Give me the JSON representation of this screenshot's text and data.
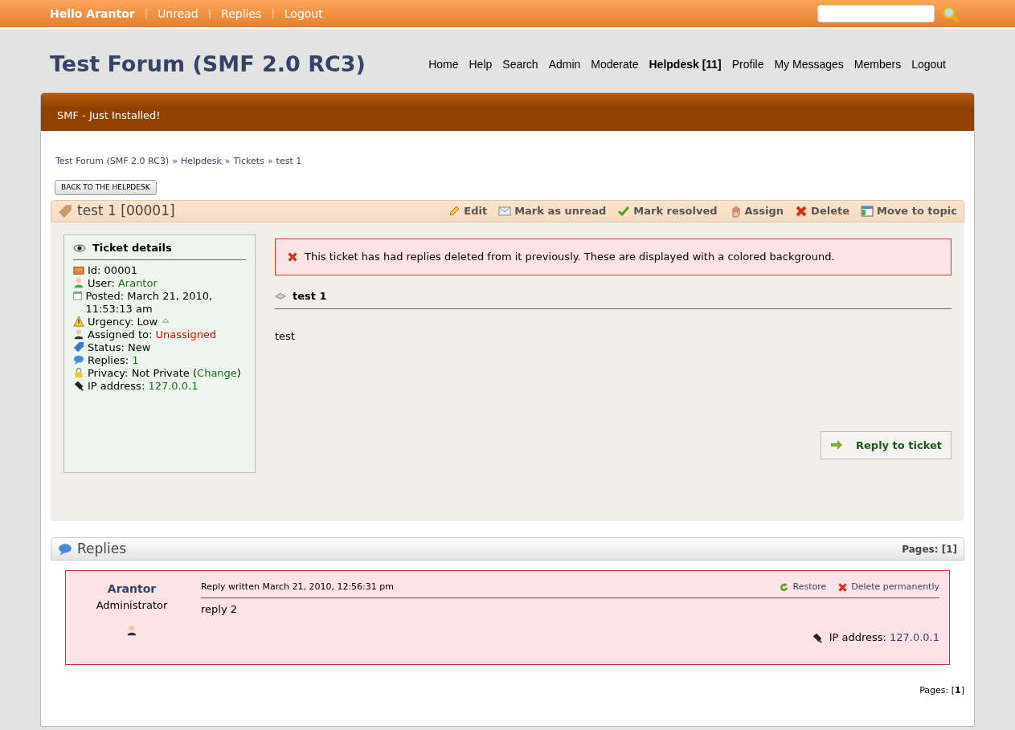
{
  "top_bar": {
    "greeting": "Hello Arantor",
    "separator": "|",
    "links": [
      "Unread",
      "Replies",
      "Logout"
    ]
  },
  "header": {
    "title": "Test Forum (SMF 2.0 RC3)",
    "menu": [
      {
        "label": "Home",
        "selected": false
      },
      {
        "label": "Help",
        "selected": false
      },
      {
        "label": "Search",
        "selected": false
      },
      {
        "label": "Admin",
        "selected": false
      },
      {
        "label": "Moderate",
        "selected": false
      },
      {
        "label": "Helpdesk [11]",
        "selected": true
      },
      {
        "label": "Profile",
        "selected": false
      },
      {
        "label": "My Messages",
        "selected": false
      },
      {
        "label": "Members",
        "selected": false
      },
      {
        "label": "Logout",
        "selected": false
      }
    ]
  },
  "banner": "SMF - Just Installed!",
  "breadcrumbs": {
    "separator": "»",
    "items": [
      "Test Forum (SMF 2.0 RC3)",
      "Helpdesk",
      "Tickets",
      "test 1"
    ]
  },
  "back_button": "BACK TO THE HELPDESK",
  "ticket": {
    "title": "test 1 [00001]",
    "actions": [
      {
        "kind": "edit",
        "label": "Edit"
      },
      {
        "kind": "unread",
        "label": "Mark as unread"
      },
      {
        "kind": "resolve",
        "label": "Mark resolved"
      },
      {
        "kind": "assign",
        "label": "Assign"
      },
      {
        "kind": "delete",
        "label": "Delete"
      },
      {
        "kind": "move",
        "label": "Move to topic"
      }
    ],
    "details": {
      "heading": "Ticket details",
      "rows": [
        {
          "kind": "id",
          "parts": [
            {
              "text": "Id: 00001"
            }
          ]
        },
        {
          "kind": "user",
          "parts": [
            {
              "text": "User: "
            },
            {
              "text": "Arantor",
              "link": true
            }
          ]
        },
        {
          "kind": "posted",
          "parts": [
            {
              "text": "Posted: March 21, 2010, 11:53:13 am"
            }
          ]
        },
        {
          "kind": "urgency",
          "parts": [
            {
              "text": "Urgency: Low"
            }
          ],
          "raise": true
        },
        {
          "kind": "assigned",
          "parts": [
            {
              "text": "Assigned to: "
            },
            {
              "text": "Unassigned",
              "alert": true
            }
          ]
        },
        {
          "kind": "status",
          "parts": [
            {
              "text": "Status: New"
            }
          ]
        },
        {
          "kind": "replies",
          "parts": [
            {
              "text": "Replies: "
            },
            {
              "text": "1",
              "link": true
            }
          ]
        },
        {
          "kind": "privacy",
          "parts": [
            {
              "text": "Privacy: Not Private ("
            },
            {
              "text": "Change",
              "link": true
            },
            {
              "text": ")"
            }
          ]
        },
        {
          "kind": "ip",
          "parts": [
            {
              "text": "IP address: "
            },
            {
              "text": "127.0.0.1",
              "link": true
            }
          ]
        }
      ]
    },
    "notice": "This ticket has had replies deleted from it previously. These are displayed with a colored background.",
    "subject": "test 1",
    "body": "test",
    "reply_button": "Reply to ticket"
  },
  "replies": {
    "heading": "Replies",
    "pages_top": "Pages: [1]",
    "pages_bottom": "Pages: [**1**]",
    "items": [
      {
        "author": "Arantor",
        "role": "Administrator",
        "deleted": true,
        "written": "Reply written March 21, 2010, 12:56:31 pm",
        "actions": [
          {
            "kind": "restore",
            "label": "Restore"
          },
          {
            "kind": "delete",
            "label": "Delete permanently"
          }
        ],
        "body": "reply 2",
        "ip_label": "IP address:",
        "ip": "127.0.0.1"
      }
    ]
  }
}
